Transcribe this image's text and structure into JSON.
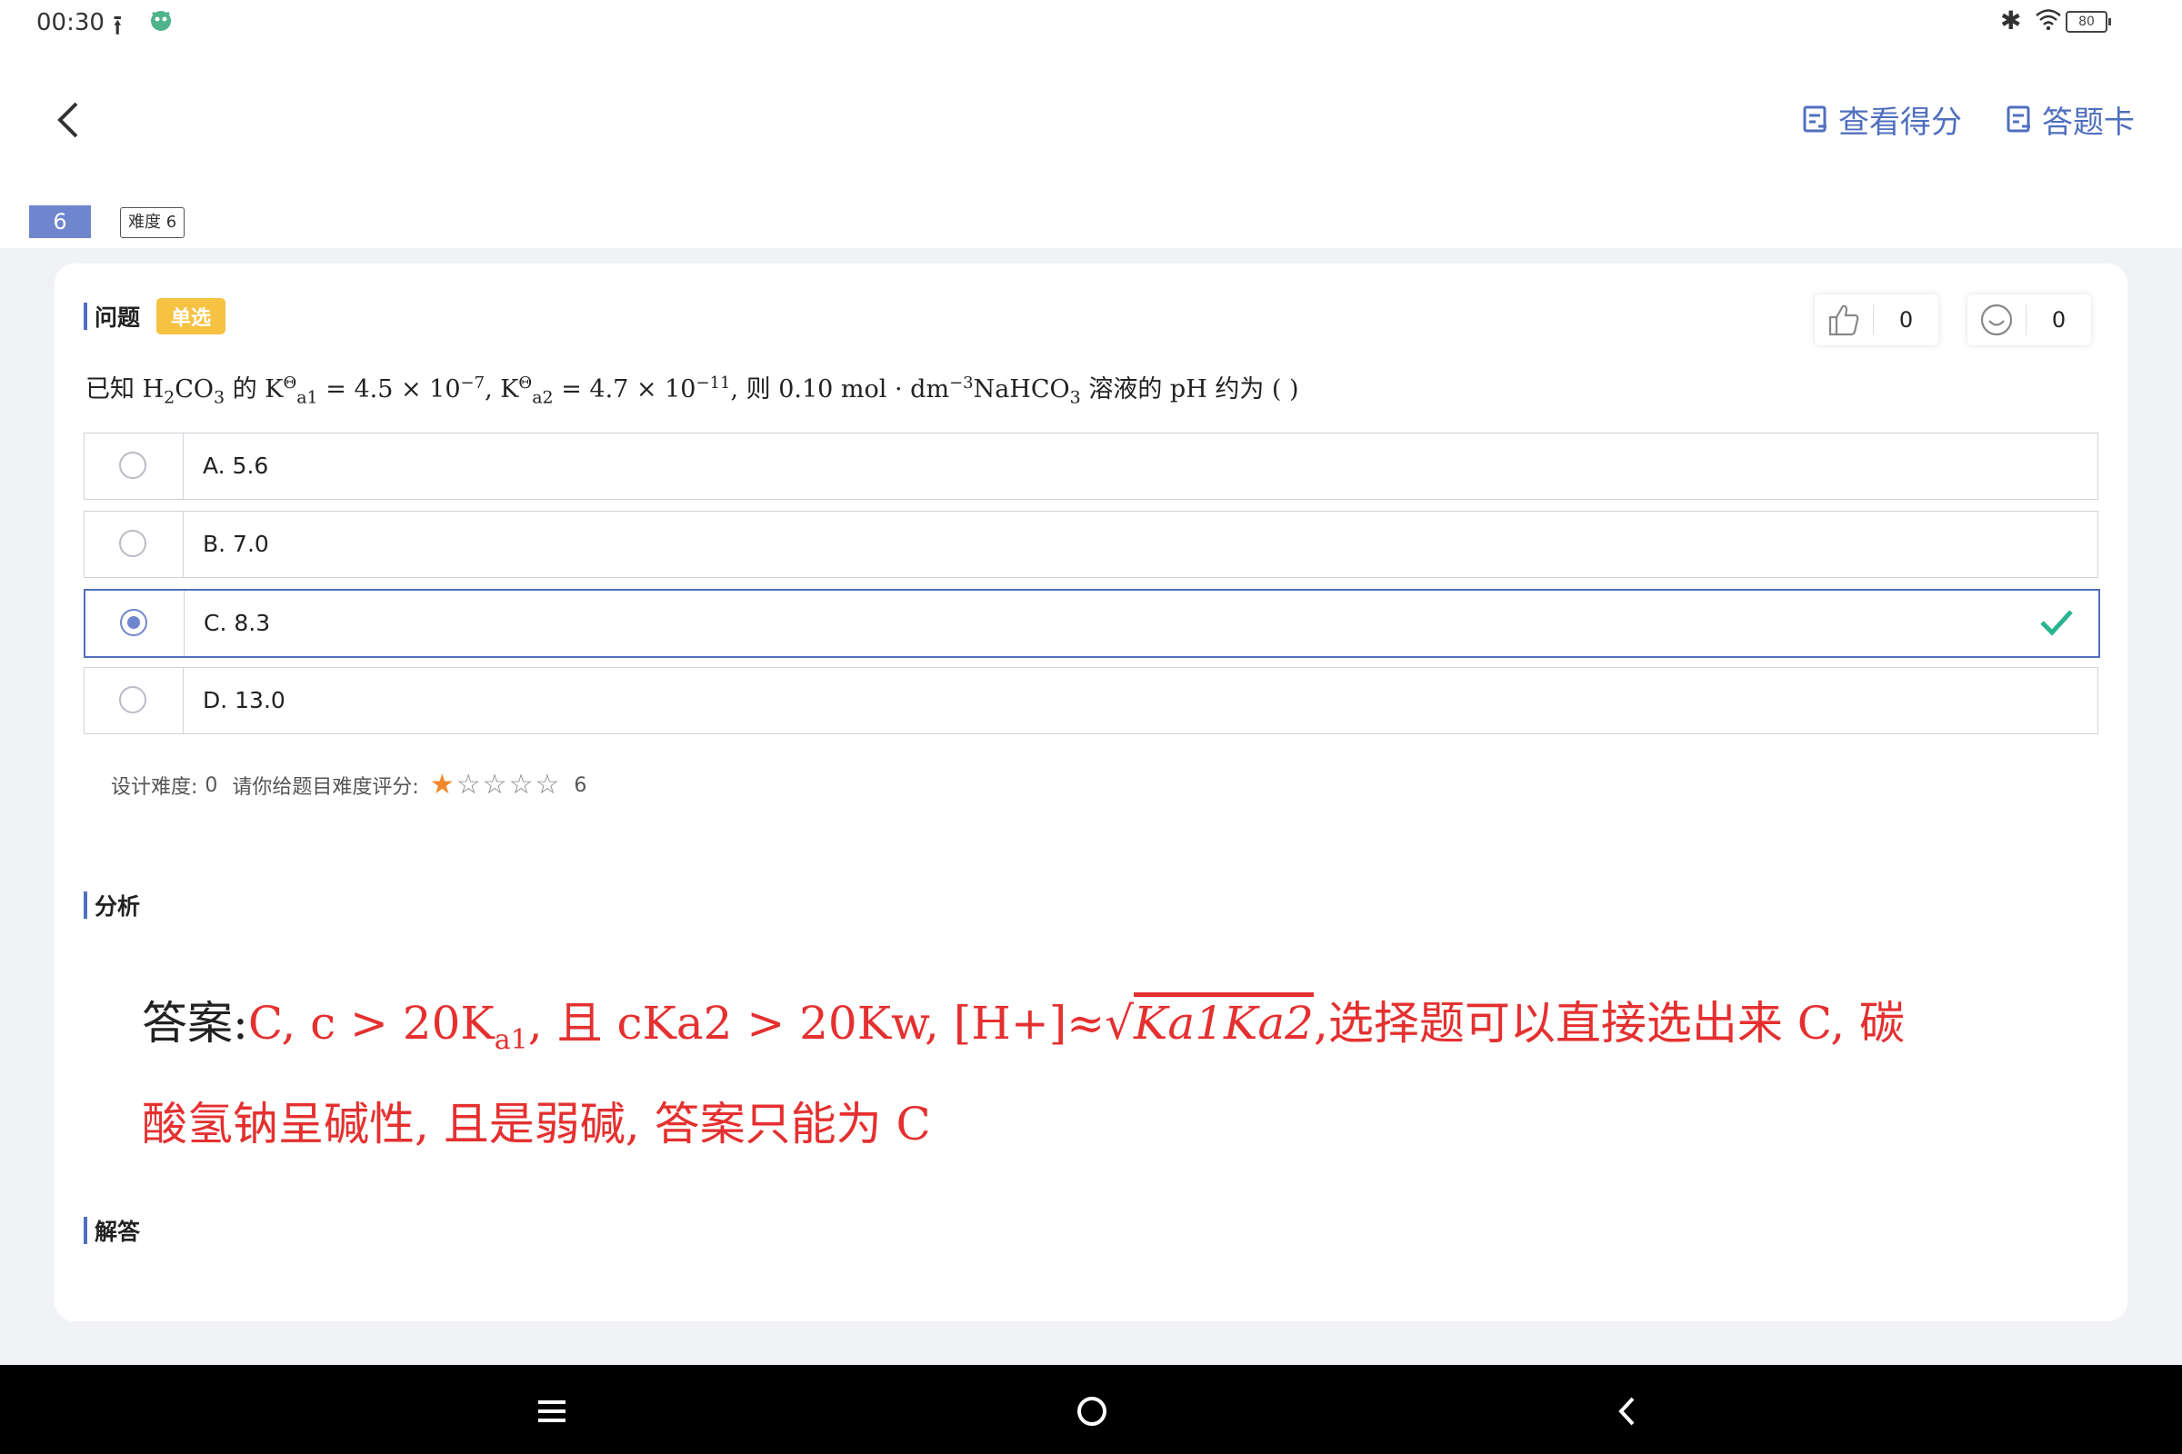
{
  "status_bar": {
    "time": "00:30",
    "battery": "80"
  },
  "header": {
    "score_link": "查看得分",
    "answer_card_link": "答题卡"
  },
  "question_meta": {
    "index": "6",
    "difficulty_badge": "难度 6"
  },
  "question": {
    "section_title": "问题",
    "type_tag": "单选",
    "likes": "0",
    "smiles": "0",
    "text": {
      "t1": "已知 H",
      "t1_sub": "2",
      "t2": "CO",
      "t2_sub": "3",
      "t3": " 的 K",
      "t3_sup": "Θ",
      "t3_sub": "a1",
      "t4": " = 4.5 × 10",
      "t4_sup": "−7",
      "t5": ", K",
      "t5_sup": "Θ",
      "t5_sub": "a2",
      "t6": " = 4.7 × 10",
      "t6_sup": "−11",
      "t7": ", 则 0.10 mol · dm",
      "t7_sup": "−3",
      "t8": "NaHCO",
      "t8_sub": "3",
      "t9": " 溶液的 pH 约为 (    )"
    },
    "options": [
      {
        "label": "A. 5.6"
      },
      {
        "label": "B. 7.0"
      },
      {
        "label": "C. 8.3"
      },
      {
        "label": "D. 13.0"
      }
    ],
    "selected_option_index": 2,
    "correct_option_index": 2
  },
  "rating": {
    "design_label": "设计难度:",
    "design_value": "0",
    "prompt": "请你给题目难度评分:",
    "stars_filled": 1,
    "stars_total": 5,
    "value": "6"
  },
  "analysis": {
    "section_title": "分析",
    "prefix": "答案:",
    "line1": "C, c > 20K",
    "line1_sub": "a1",
    "line1b": ", 且 cKa2 > 20Kw, [H+]≈√",
    "radicand": "Ka1Ka2",
    "line1c": ",选择题可以直接选出来 C, 碳",
    "line2": "酸氢钠呈碱性, 且是弱碱, 答案只能为 C"
  },
  "solution": {
    "section_title": "解答"
  },
  "colors": {
    "accent": "#4f6fbf",
    "tag": "#f5c242",
    "correct": "#2bb58f",
    "star": "#f0872a",
    "answer_red": "#e53030"
  }
}
